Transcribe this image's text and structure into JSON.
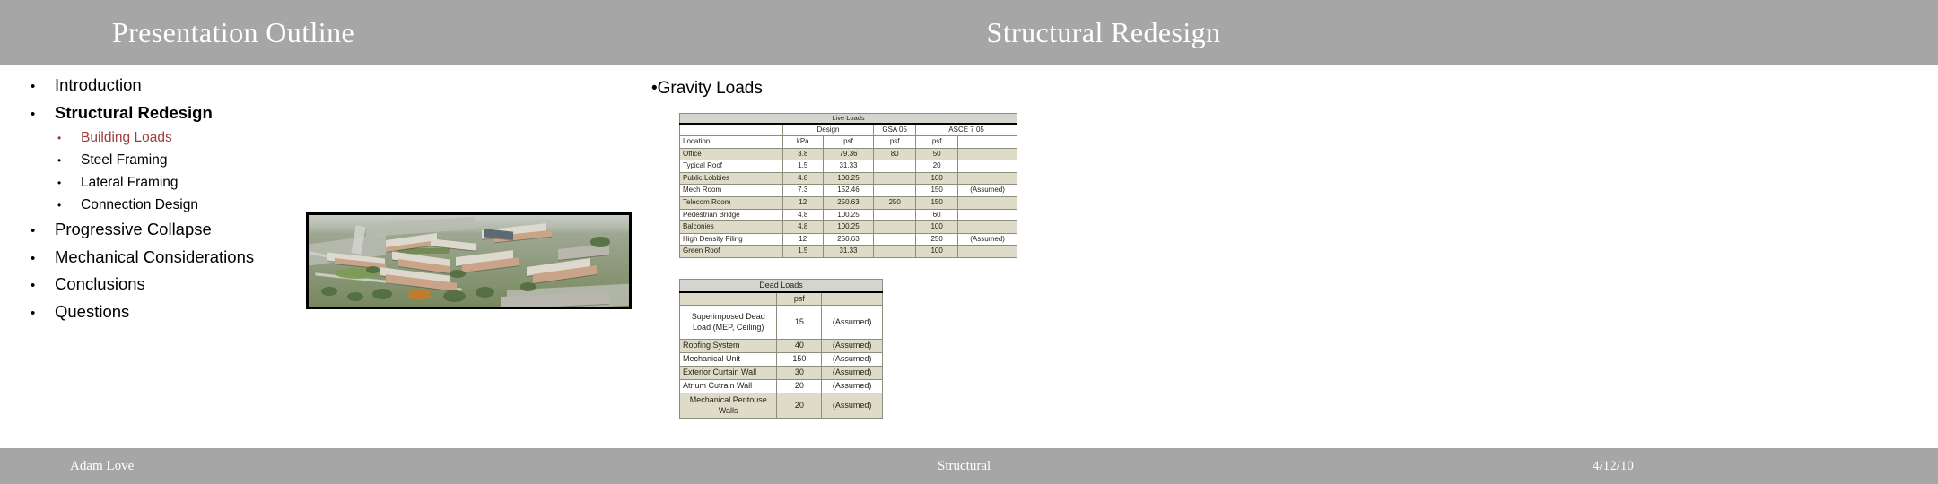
{
  "header": {
    "left_title": "Presentation Outline",
    "right_title": "Structural Redesign"
  },
  "outline": {
    "items": [
      {
        "label": "Introduction",
        "level": 1,
        "bold": false,
        "accent": false,
        "bullet": "•"
      },
      {
        "label": "Structural Redesign",
        "level": 1,
        "bold": true,
        "accent": false,
        "bullet": "•"
      },
      {
        "label": "Building Loads",
        "level": 2,
        "bold": false,
        "accent": true,
        "bullet": "•"
      },
      {
        "label": "Steel Framing",
        "level": 2,
        "bold": false,
        "accent": false,
        "bullet": "•"
      },
      {
        "label": "Lateral Framing",
        "level": 2,
        "bold": false,
        "accent": false,
        "bullet": "•"
      },
      {
        "label": "Connection Design",
        "level": 2,
        "bold": false,
        "accent": false,
        "bullet": "•"
      },
      {
        "label": "Progressive Collapse",
        "level": 1,
        "bold": false,
        "accent": false,
        "bullet": "•"
      },
      {
        "label": "Mechanical Considerations",
        "level": 1,
        "bold": false,
        "accent": false,
        "bullet": "•"
      },
      {
        "label": "Conclusions",
        "level": 1,
        "bold": false,
        "accent": false,
        "bullet": "•"
      },
      {
        "label": "Questions",
        "level": 1,
        "bold": false,
        "accent": false,
        "bullet": "•"
      }
    ]
  },
  "main": {
    "gravity_heading": "•Gravity Loads",
    "live_loads": {
      "title": "Live Loads",
      "group_headers": [
        "",
        "Design",
        "GSA 05",
        "ASCE 7 05",
        ""
      ],
      "unit_row": [
        "Location",
        "kPa",
        "psf",
        "psf",
        "psf",
        ""
      ],
      "rows": [
        {
          "location": "Office",
          "kpa": "3.8",
          "design_psf": "79.36",
          "gsa_psf": "80",
          "asce_psf": "50",
          "note": ""
        },
        {
          "location": "Typical Roof",
          "kpa": "1.5",
          "design_psf": "31.33",
          "gsa_psf": "",
          "asce_psf": "20",
          "note": ""
        },
        {
          "location": "Public Lobbies",
          "kpa": "4.8",
          "design_psf": "100.25",
          "gsa_psf": "",
          "asce_psf": "100",
          "note": ""
        },
        {
          "location": "Mech Room",
          "kpa": "7.3",
          "design_psf": "152.46",
          "gsa_psf": "",
          "asce_psf": "150",
          "note": "(Assumed)"
        },
        {
          "location": "Telecom Room",
          "kpa": "12",
          "design_psf": "250.63",
          "gsa_psf": "250",
          "asce_psf": "150",
          "note": ""
        },
        {
          "location": "Pedestrian Bridge",
          "kpa": "4.8",
          "design_psf": "100.25",
          "gsa_psf": "",
          "asce_psf": "60",
          "note": ""
        },
        {
          "location": "Balconies",
          "kpa": "4.8",
          "design_psf": "100.25",
          "gsa_psf": "",
          "asce_psf": "100",
          "note": ""
        },
        {
          "location": "High Density Filing",
          "kpa": "12",
          "design_psf": "250.63",
          "gsa_psf": "",
          "asce_psf": "250",
          "note": "(Assumed)"
        },
        {
          "location": "Green Roof",
          "kpa": "1.5",
          "design_psf": "31.33",
          "gsa_psf": "",
          "asce_psf": "100",
          "note": ""
        }
      ]
    },
    "dead_loads": {
      "title": "Dead Loads",
      "unit_row": [
        "",
        "psf",
        ""
      ],
      "rows": [
        {
          "item": "Superimposed Dead Load (MEP, Ceiling)",
          "psf": "15",
          "note": "(Assumed)"
        },
        {
          "item": "Roofing System",
          "psf": "40",
          "note": "(Assumed)"
        },
        {
          "item": "Mechanical Unit",
          "psf": "150",
          "note": "(Assumed)"
        },
        {
          "item": "Exterior Curtain Wall",
          "psf": "30",
          "note": "(Assumed)"
        },
        {
          "item": "Atrium Cutrain Wall",
          "psf": "20",
          "note": "(Assumed)"
        },
        {
          "item": "Mechanical Pentouse Walls",
          "psf": "20",
          "note": "(Assumed)"
        }
      ]
    },
    "campus_image_alt": "aerial-campus-rendering"
  },
  "footer": {
    "name": "Adam Love",
    "section": "Structural",
    "date": "4/12/10"
  },
  "colors": {
    "band": "#a6a6a6",
    "accent_red": "#9e3b3b",
    "table_alt_row": "#dedcc8",
    "table_title_bg": "#d5d5d0"
  }
}
